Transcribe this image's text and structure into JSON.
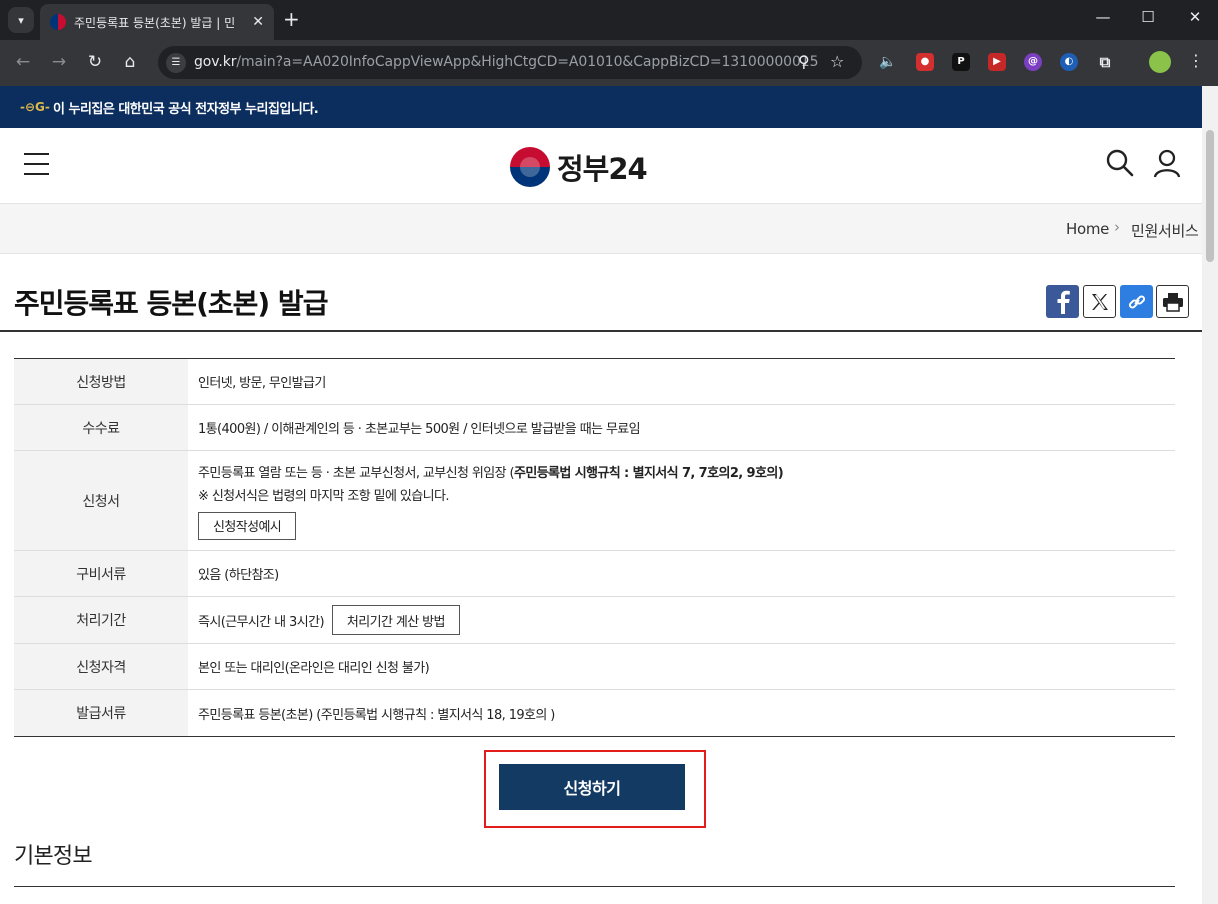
{
  "browser": {
    "tab_title": "주민등록표 등본(초본) 발급 | 민",
    "url_host": "gov.kr",
    "url_path": "/main?a=AA020InfoCappViewApp&HighCtgCD=A01010&CappBizCD=13100000015",
    "icons": [
      "tab-list-icon",
      "close-tab-icon",
      "new-tab-icon",
      "minimize-icon",
      "maximize-icon",
      "close-window-icon",
      "back-icon",
      "forward-icon",
      "reload-icon",
      "home-icon",
      "site-info-icon",
      "zoom-icon",
      "bookmark-star-icon",
      "extensions-icon",
      "profile-icon",
      "menu-icon"
    ]
  },
  "banner": {
    "text": "이 누리집은 대한민국 공식 전자정부 누리집입니다."
  },
  "header": {
    "logo_text": "정부24"
  },
  "breadcrumb": {
    "home": "Home",
    "current": "민원서비스"
  },
  "page": {
    "title": "주민등록표 등본(초본) 발급"
  },
  "share": [
    "facebook-icon",
    "x-icon",
    "link-icon",
    "print-icon"
  ],
  "info": {
    "method_label": "신청방법",
    "method_value": "인터넷, 방문, 무인발급기",
    "fee_label": "수수료",
    "fee_value": "1통(400원) / 이해관계인의 등 · 초본교부는 500원 / 인터넷으로 발급받을 때는 무료임",
    "form_label": "신청서",
    "form_value_prefix": "주민등록표 열람 또는 등 · 초본 교부신청서, 교부신청 위임장 (",
    "form_value_bold": "주민등록법 시행규칙 : 별지서식 7, 7호의2, 9호의",
    "form_value_suffix": ")",
    "form_note": "※ 신청서식은 법령의 마지막 조항 밑에 있습니다.",
    "form_example_button": "신청작성예시",
    "docs_label": "구비서류",
    "docs_value": "있음 (하단참조)",
    "period_label": "처리기간",
    "period_value": "즉시(근무시간 내 3시간)",
    "period_button": "처리기간 계산 방법",
    "eligibility_label": "신청자격",
    "eligibility_value": "본인 또는 대리인(온라인은 대리인 신청 불가)",
    "issued_label": "발급서류",
    "issued_value": "주민등록표 등본(초본) (주민등록법 시행규칙 : 별지서식 18, 19호의 )"
  },
  "apply_button": "신청하기",
  "section": {
    "basic_info": "기본정보"
  },
  "colors": {
    "banner": "#0b2e5f",
    "apply_button": "#133a63",
    "highlight_box": "#e31c1c"
  }
}
